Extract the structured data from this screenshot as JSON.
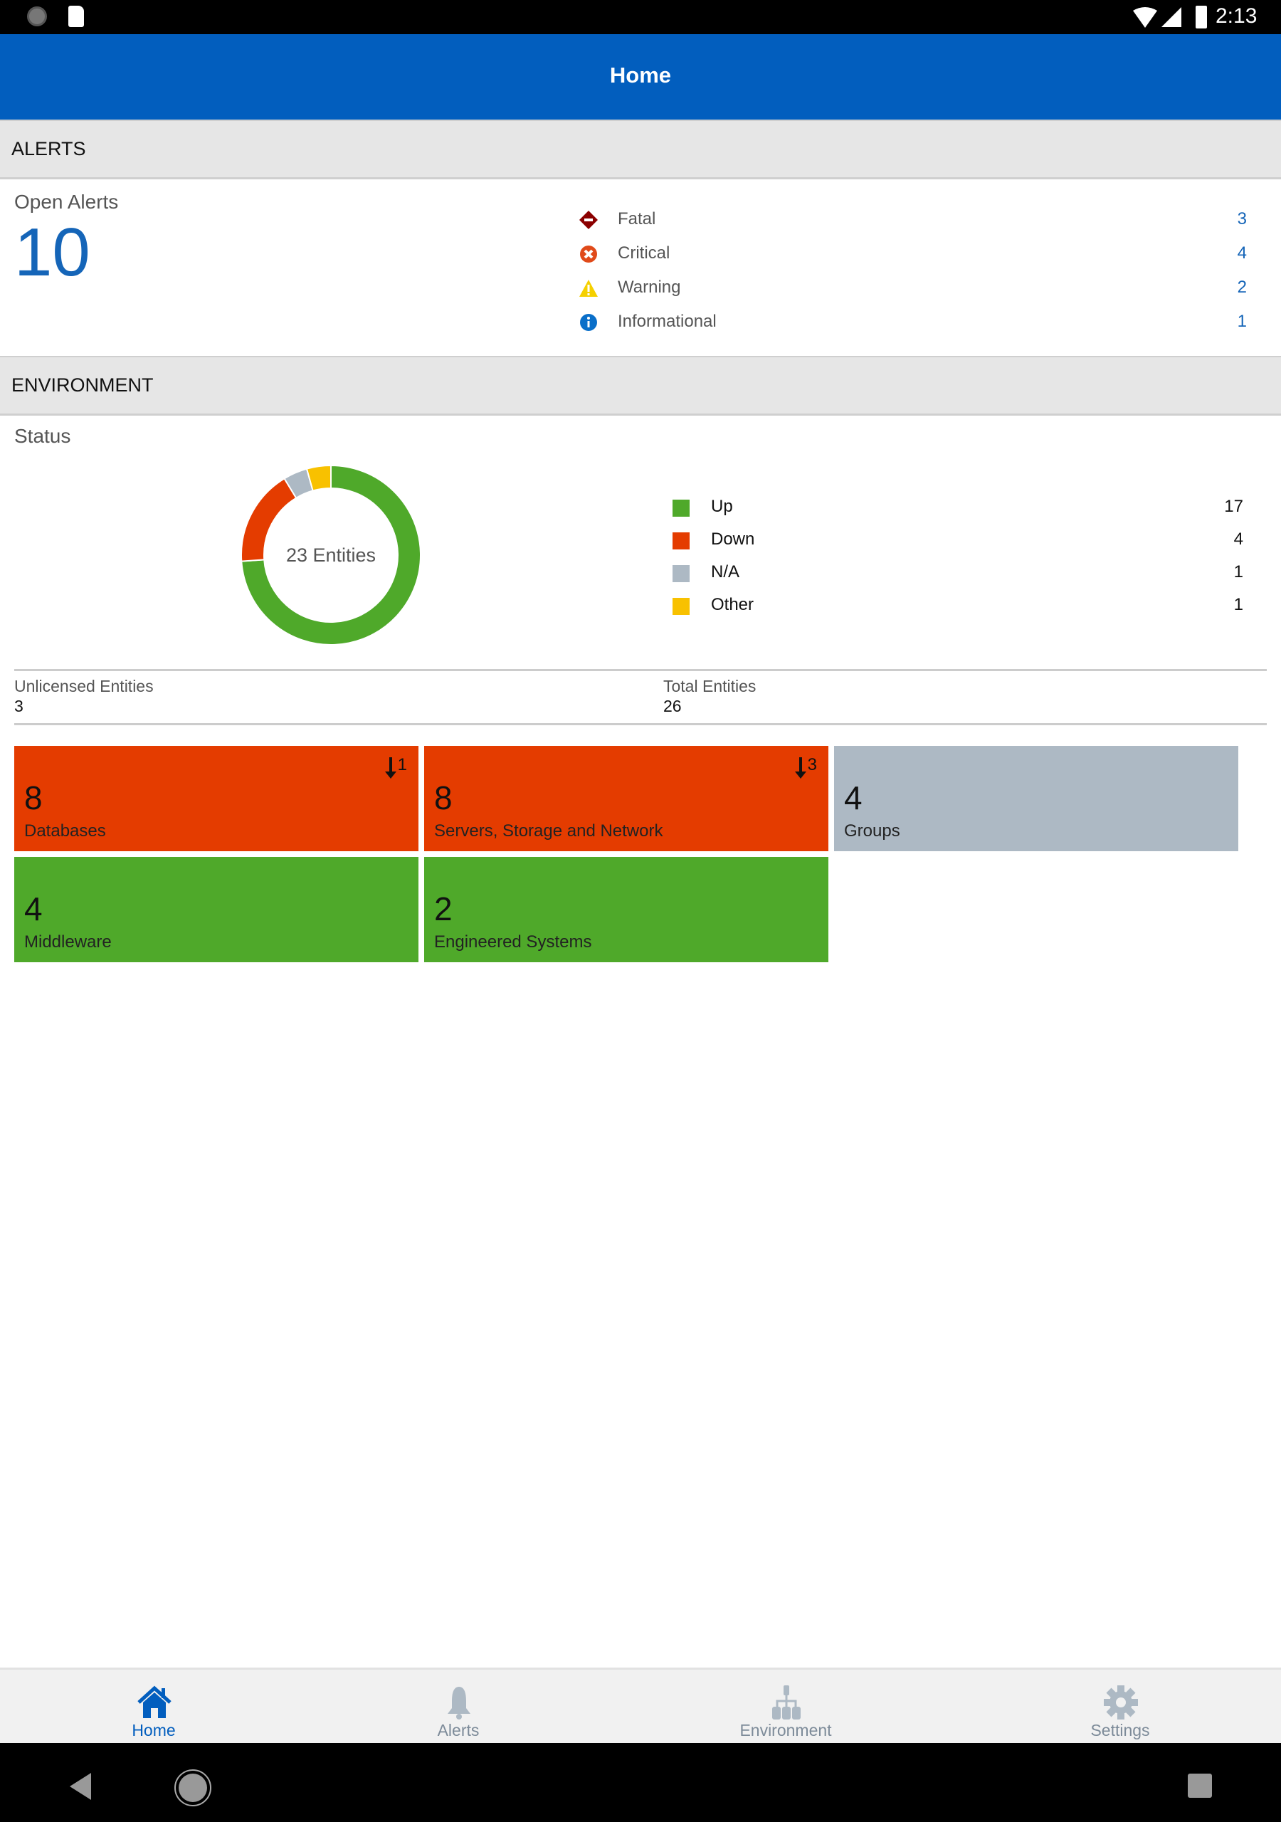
{
  "status_bar": {
    "time": "2:13"
  },
  "app_bar": {
    "title": "Home"
  },
  "alerts": {
    "section_title": "ALERTS",
    "open_label": "Open Alerts",
    "open_count": "10",
    "items": [
      {
        "label": "Fatal",
        "count": "3",
        "icon": "fatal-icon",
        "color": "#8b0000"
      },
      {
        "label": "Critical",
        "count": "4",
        "icon": "critical-icon",
        "color": "#e04a1a"
      },
      {
        "label": "Warning",
        "count": "2",
        "icon": "warning-icon",
        "color": "#f5d000"
      },
      {
        "label": "Informational",
        "count": "1",
        "icon": "info-icon",
        "color": "#0a6fc9"
      }
    ]
  },
  "environment": {
    "section_title": "ENVIRONMENT",
    "status_label": "Status",
    "donut_center": "23 Entities",
    "unlicensed_label": "Unlicensed Entities",
    "unlicensed_value": "3",
    "total_label": "Total Entities",
    "total_value": "26",
    "tiles": [
      {
        "count": "8",
        "name": "Databases",
        "badge": "1",
        "color": "#e43c00"
      },
      {
        "count": "8",
        "name": "Servers, Storage and Network",
        "badge": "3",
        "color": "#e43c00"
      },
      {
        "count": "4",
        "name": "Groups",
        "badge": "",
        "color": "#adb9c4"
      },
      {
        "count": "4",
        "name": "Middleware",
        "badge": "",
        "color": "#4fa92a"
      },
      {
        "count": "2",
        "name": "Engineered Systems",
        "badge": "",
        "color": "#4fa92a"
      }
    ]
  },
  "chart_data": {
    "type": "pie",
    "title": "Status",
    "center_label": "23 Entities",
    "categories": [
      "Up",
      "Down",
      "N/A",
      "Other"
    ],
    "values": [
      17,
      4,
      1,
      1
    ],
    "colors": [
      "#4fa92a",
      "#e43c00",
      "#adb9c4",
      "#f8c100"
    ],
    "legend": "right"
  },
  "bottom_nav": {
    "items": [
      {
        "label": "Home",
        "active": true
      },
      {
        "label": "Alerts",
        "active": false
      },
      {
        "label": "Environment",
        "active": false
      },
      {
        "label": "Settings",
        "active": false
      }
    ],
    "active_color": "#025ebe",
    "inactive_color": "#7d8b99"
  }
}
